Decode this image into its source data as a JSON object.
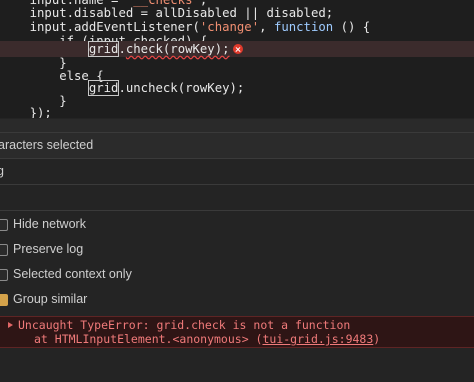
{
  "editor": {
    "lines": [
      "    input.name = '__checks';",
      "    input.disabled = allDisabled || disabled;",
      "    input.addEventListener('change', function () {",
      "        if (input.checked) {",
      "            grid.check(rowKey);",
      "        }",
      "        else {",
      "            grid.uncheck(rowKey);",
      "        }",
      "    });"
    ],
    "error_icon": "error-x-icon"
  },
  "status": {
    "selection_text": "aracters selected",
    "filter_value": "g"
  },
  "settings": {
    "options": [
      {
        "label": "Hide network",
        "checked": false
      },
      {
        "label": "Preserve log",
        "checked": false
      },
      {
        "label": "Selected context only",
        "checked": false
      },
      {
        "label": "Group similar",
        "checked": true
      }
    ]
  },
  "console": {
    "error_line1": "Uncaught TypeError: grid.check is not a function",
    "error_at": "at HTMLInputElement.<anonymous> (",
    "error_link": "tui-grid.js:9483",
    "error_close": ")",
    "icon": "expand-triangle-icon"
  },
  "colors": {
    "background": "#242424",
    "error_text": "#f07a7a",
    "checkbox_checked": "#d4a24a"
  }
}
